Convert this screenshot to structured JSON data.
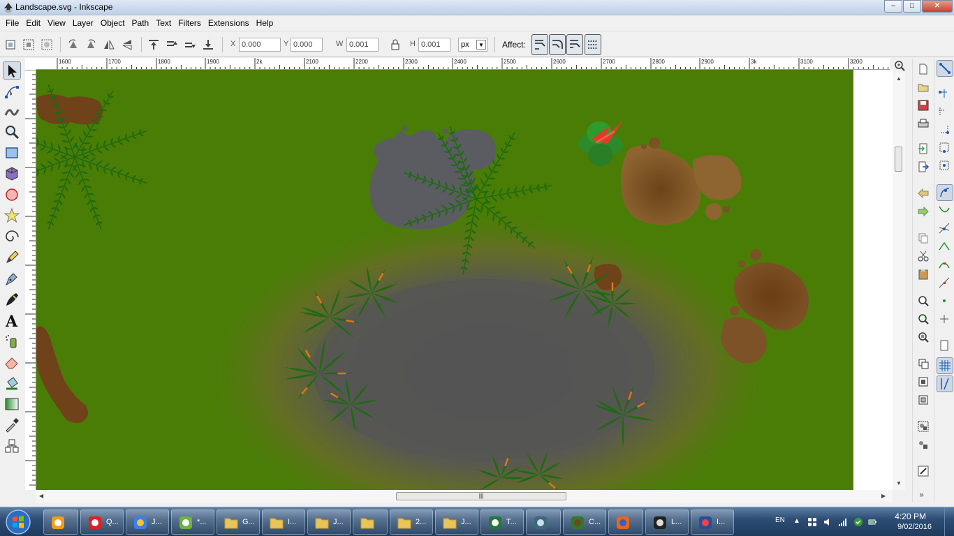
{
  "window": {
    "title": "Landscape.svg - Inkscape",
    "min": "–",
    "max": "□",
    "close": "✕"
  },
  "menu": [
    "File",
    "Edit",
    "View",
    "Layer",
    "Object",
    "Path",
    "Text",
    "Filters",
    "Extensions",
    "Help"
  ],
  "controls": {
    "x_label": "X",
    "x_value": "0.000",
    "y_label": "Y",
    "y_value": "0.000",
    "w_label": "W",
    "w_value": "0.001",
    "h_label": "H",
    "h_value": "0.001",
    "unit": "px",
    "affect_label": "Affect:"
  },
  "ruler": {
    "h_labels": [
      "1600",
      "1700",
      "1800",
      "1900",
      "2k",
      "2100",
      "2200",
      "2300",
      "2400",
      "2500",
      "2600",
      "2700",
      "2800",
      "2900",
      "3k",
      "3100",
      "3200"
    ]
  },
  "toolbox": [
    "selector-tool",
    "node-tool",
    "tweak-tool",
    "zoom-tool",
    "rect-tool",
    "box3d-tool",
    "ellipse-tool",
    "star-tool",
    "spiral-tool",
    "pencil-tool",
    "pen-tool",
    "calligraphy-tool",
    "text-tool",
    "spray-tool",
    "eraser-tool",
    "bucket-tool",
    "gradient-tool",
    "dropper-tool",
    "connector-tool"
  ],
  "canvas": {
    "background": "#4a7d06",
    "pond": "#545456",
    "rock": "#5a5c61",
    "dirt": "#7a5226",
    "fern": "#1e6a10",
    "flower": "#e23a2a",
    "orange_accent": "#e5731b"
  },
  "taskbar": {
    "items": [
      {
        "icon": "media-player-icon",
        "label": ""
      },
      {
        "icon": "adobe-icon",
        "label": "Q..."
      },
      {
        "icon": "chrome-icon",
        "label": "J..."
      },
      {
        "icon": "sketch-icon",
        "label": "*..."
      },
      {
        "icon": "folder-icon",
        "label": "G..."
      },
      {
        "icon": "folder-icon",
        "label": "I..."
      },
      {
        "icon": "folder-icon",
        "label": "J..."
      },
      {
        "icon": "folder-icon",
        "label": ""
      },
      {
        "icon": "folder-icon",
        "label": "2..."
      },
      {
        "icon": "folder-icon",
        "label": "J..."
      },
      {
        "icon": "excel-icon",
        "label": "T..."
      },
      {
        "icon": "monitor-icon",
        "label": ""
      },
      {
        "icon": "tree-icon",
        "label": "C..."
      },
      {
        "icon": "firefox-icon",
        "label": ""
      },
      {
        "icon": "inkscape-icon",
        "label": "L..."
      },
      {
        "icon": "image-editor-icon",
        "label": "I..."
      }
    ],
    "lang": "EN",
    "time": "4:20 PM",
    "date": "9/02/2016"
  }
}
